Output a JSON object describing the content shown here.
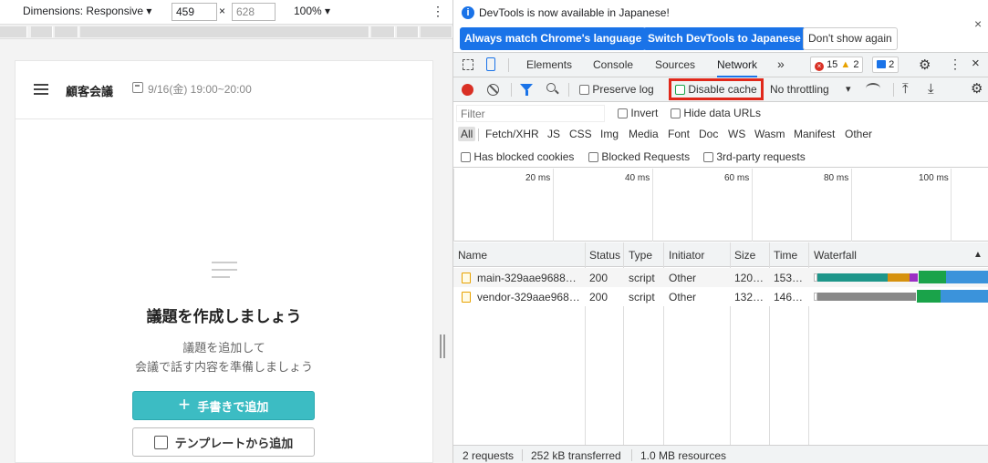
{
  "device_toolbar": {
    "dimensions_label": "Dimensions: Responsive ▾",
    "width": "459",
    "times": "×",
    "height": "628",
    "zoom": "100% ▾",
    "more": "⋮"
  },
  "page": {
    "meeting_title": "顧客会議",
    "meeting_date": "9/16(金) 19:00~20:00",
    "empty_title": "議題を作成しましょう",
    "empty_desc1": "議題を追加して",
    "empty_desc2": "会議で話す内容を準備しましょう",
    "add_button": "手書きで追加",
    "add_plus": "+",
    "template_button": "テンプレートから追加"
  },
  "devtools": {
    "info": {
      "icon": "i",
      "message": "DevTools is now available in Japanese!",
      "match_button": "Always match Chrome's language",
      "switch_button": "Switch DevTools to Japanese",
      "dismiss_button": "Don't show again",
      "close": "×"
    },
    "tabs": [
      "Elements",
      "Console",
      "Sources",
      "Network"
    ],
    "more_tabs": "»",
    "badges": {
      "errors": "15",
      "error_icon": "×",
      "warnings": "2",
      "warning_icon": "▲",
      "messages": "2"
    },
    "settings_icon": "⚙",
    "kebab": "⋮",
    "close": "×",
    "toolbar": {
      "preserve_log": "Preserve log",
      "disable_cache": "Disable cache",
      "throttling": "No throttling",
      "throttling_arrow": "▾",
      "upload": "⤒",
      "download": "⤓"
    },
    "filter": {
      "placeholder": "Filter",
      "invert": "Invert",
      "hide_data_urls": "Hide data URLs"
    },
    "types": [
      "All",
      "Fetch/XHR",
      "JS",
      "CSS",
      "Img",
      "Media",
      "Font",
      "Doc",
      "WS",
      "Wasm",
      "Manifest",
      "Other"
    ],
    "blocked": {
      "has_blocked_cookies": "Has blocked cookies",
      "blocked_requests": "Blocked Requests",
      "third_party": "3rd-party requests"
    },
    "overview_ticks": [
      "20 ms",
      "40 ms",
      "60 ms",
      "80 ms",
      "100 ms"
    ],
    "columns": [
      "Name",
      "Status",
      "Type",
      "Initiator",
      "Size",
      "Time",
      "Waterfall"
    ],
    "sort_arrow": "▲",
    "rows": [
      {
        "name": "main-329aae9688…",
        "status": "200",
        "type": "script",
        "initiator": "Other",
        "size": "120…",
        "time": "153…"
      },
      {
        "name": "vendor-329aae968…",
        "status": "200",
        "type": "script",
        "initiator": "Other",
        "size": "132…",
        "time": "146…"
      }
    ],
    "status_bar": {
      "requests": "2 requests",
      "transferred": "252 kB transferred",
      "resources": "1.0 MB resources"
    },
    "colors": {
      "accent": "#1a73e8",
      "record": "#d93025",
      "highlight": "#e0281b",
      "teal": "#3cbcc3",
      "wf_teal": "#1e968a",
      "wf_orange": "#d6910e",
      "wf_purple": "#9b2fc4",
      "wf_green": "#1aa34a",
      "wf_blue": "#3b93db",
      "wf_grey": "#888888"
    }
  }
}
